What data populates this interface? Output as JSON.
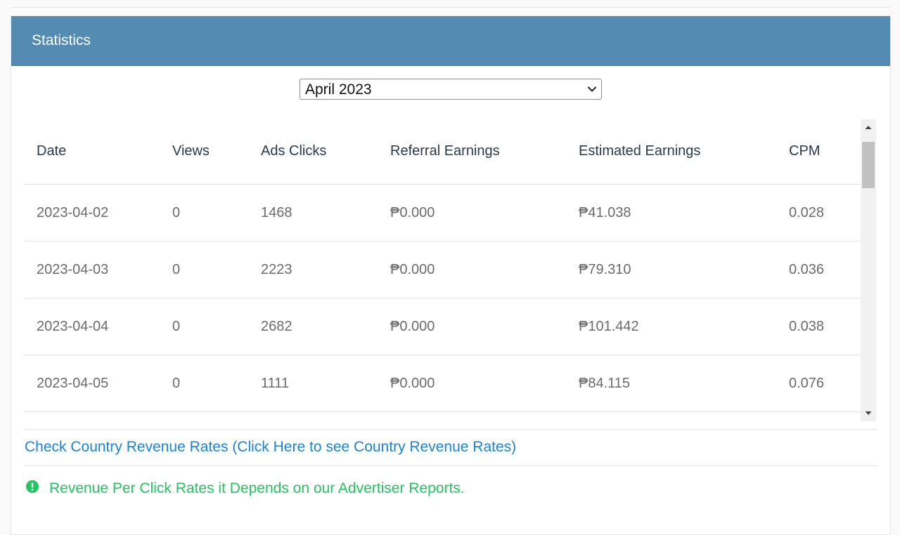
{
  "card": {
    "title": "Statistics"
  },
  "month_select": {
    "value": "April 2023"
  },
  "table": {
    "headers": [
      "Date",
      "Views",
      "Ads Clicks",
      "Referral Earnings",
      "Estimated Earnings",
      "CPM"
    ],
    "rows": [
      [
        "2023-04-02",
        "0",
        "1468",
        "₱0.000",
        "₱41.038",
        "0.028"
      ],
      [
        "2023-04-03",
        "0",
        "2223",
        "₱0.000",
        "₱79.310",
        "0.036"
      ],
      [
        "2023-04-04",
        "0",
        "2682",
        "₱0.000",
        "₱101.442",
        "0.038"
      ],
      [
        "2023-04-05",
        "0",
        "1111",
        "₱0.000",
        "₱84.115",
        "0.076"
      ]
    ]
  },
  "links": {
    "country_rates": "Check Country Revenue Rates (Click Here to see Country Revenue Rates)"
  },
  "notice": {
    "text": "Revenue Per Click Rates it Depends on our Advertiser Reports.",
    "icon": "exclamation-circle-icon"
  },
  "colors": {
    "header_bg": "#548bb3",
    "link": "#1a83d6",
    "notice": "#22c55e"
  }
}
